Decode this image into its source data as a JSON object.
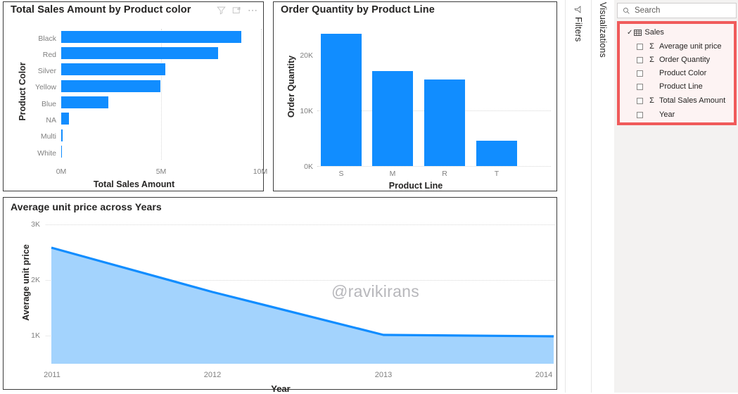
{
  "app": {
    "watermark": "@ravikirans",
    "accent_blue": "#118DFF",
    "area_fill": "#A3D3FD",
    "highlight_red": "#F05B5B"
  },
  "visuals": {
    "bar": {
      "title": "Total Sales Amount by Product color",
      "icons": [
        "filter-icon",
        "focus-mode-icon",
        "more-options-icon"
      ]
    },
    "column": {
      "title": "Order Quantity by Product Line"
    },
    "area": {
      "title": "Average unit price across Years"
    }
  },
  "panes": {
    "filters_tab": "Filters",
    "visualizations_tab": "Visualizations",
    "search_placeholder": "Search",
    "table_name": "Sales",
    "fields": [
      {
        "label": "Average unit price",
        "is_measure": true
      },
      {
        "label": "Order Quantity",
        "is_measure": true
      },
      {
        "label": "Product Color",
        "is_measure": false
      },
      {
        "label": "Product Line",
        "is_measure": false
      },
      {
        "label": "Total Sales Amount",
        "is_measure": true
      },
      {
        "label": "Year",
        "is_measure": false
      }
    ],
    "sigma_glyph": "Σ"
  },
  "chart_data": [
    {
      "type": "bar",
      "title": "Total Sales Amount by Product color",
      "orientation": "horizontal",
      "xlabel": "Total Sales Amount",
      "ylabel": "Product Color",
      "categories": [
        "Black",
        "Red",
        "Silver",
        "Yellow",
        "Blue",
        "NA",
        "Multi",
        "White"
      ],
      "values": [
        9.0,
        7.85,
        5.2,
        4.95,
        2.35,
        0.37,
        0.06,
        0.02
      ],
      "unit": "M",
      "xlim": [
        0,
        10
      ],
      "xticks": [
        0,
        5,
        10
      ],
      "xticklabels": [
        "0M",
        "5M",
        "10M"
      ],
      "grid": true,
      "legend": false,
      "color": "#118DFF"
    },
    {
      "type": "bar",
      "title": "Order Quantity by Product Line",
      "orientation": "vertical",
      "xlabel": "Product Line",
      "ylabel": "Order Quantity",
      "categories": [
        "S",
        "M",
        "R",
        "T"
      ],
      "values": [
        23500,
        17000,
        15500,
        4600
      ],
      "ylim": [
        0,
        29400
      ],
      "yticks": [
        0,
        10000,
        20000
      ],
      "yticklabels": [
        "0K",
        "10K",
        "20K"
      ],
      "grid": true,
      "legend": false,
      "color": "#118DFF"
    },
    {
      "type": "area",
      "title": "Average unit price across Years",
      "xlabel": "Year",
      "ylabel": "Average unit price",
      "x": [
        2011,
        2012,
        2013,
        2014
      ],
      "xticklabels": [
        "2011",
        "2012",
        "2013",
        "2014"
      ],
      "values": [
        2720,
        1680,
        680,
        640
      ],
      "ylim": [
        0,
        3260
      ],
      "yticks": [
        1000,
        2000,
        3000
      ],
      "yticklabels": [
        "1K",
        "2K",
        "3K"
      ],
      "grid": true,
      "legend": false,
      "line_color": "#118DFF",
      "fill_color": "#A3D3FD"
    }
  ]
}
